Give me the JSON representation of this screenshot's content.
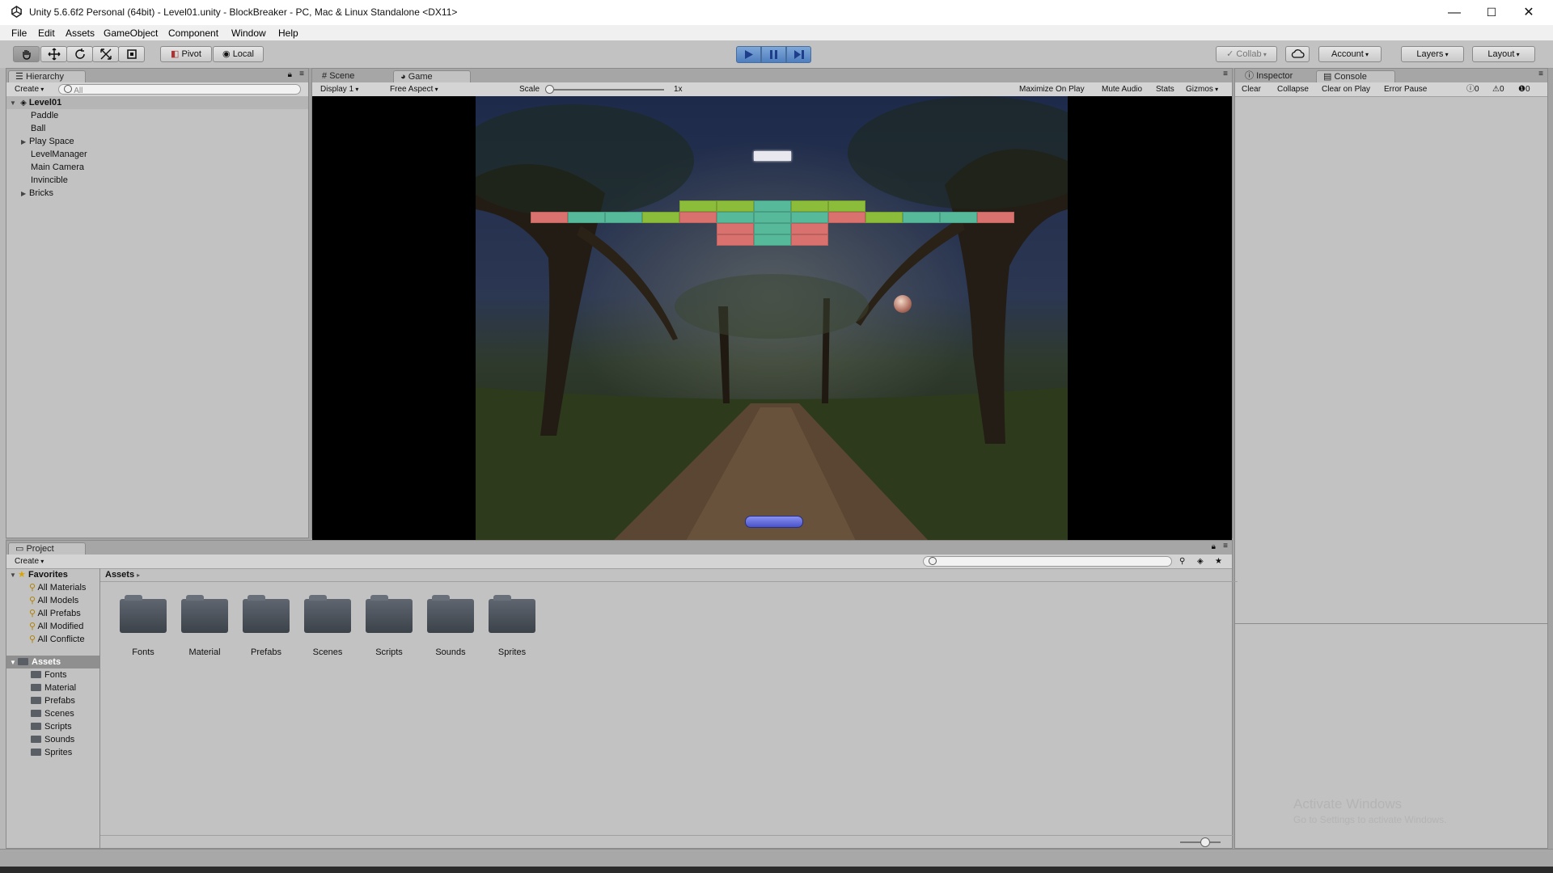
{
  "window": {
    "title": "Unity 5.6.6f2 Personal (64bit) - Level01.unity - BlockBreaker - PC, Mac & Linux Standalone <DX11>",
    "minimize": "—",
    "maximize": "☐",
    "close": "✕"
  },
  "menu": {
    "items": [
      {
        "label": "File"
      },
      {
        "label": "Edit"
      },
      {
        "label": "Assets"
      },
      {
        "label": "GameObject"
      },
      {
        "label": "Component"
      },
      {
        "label": "Window"
      },
      {
        "label": "Help"
      }
    ]
  },
  "toolbar": {
    "pivot": "Pivot",
    "local": "Local",
    "collab": "Collab",
    "account": "Account",
    "layers": "Layers",
    "layout": "Layout",
    "playing": true
  },
  "hierarchy": {
    "tab": "Hierarchy",
    "create": "Create",
    "search_placeholder": "All",
    "scene": "Level01",
    "items": [
      {
        "label": "Paddle",
        "expandable": false
      },
      {
        "label": "Ball",
        "expandable": false
      },
      {
        "label": "Play Space",
        "expandable": true
      },
      {
        "label": "LevelManager",
        "expandable": false
      },
      {
        "label": "Main Camera",
        "expandable": false
      },
      {
        "label": "Invincible",
        "expandable": false
      },
      {
        "label": "Bricks",
        "expandable": true
      }
    ]
  },
  "center": {
    "tabs": [
      {
        "label": "Scene",
        "active": false
      },
      {
        "label": "Game",
        "active": true
      }
    ],
    "display": "Display 1",
    "aspect": "Free Aspect",
    "scale_label": "Scale",
    "scale_value": "1x",
    "options": [
      "Maximize On Play",
      "Mute Audio",
      "Stats",
      "Gizmos"
    ]
  },
  "right": {
    "tabs": [
      {
        "label": "Inspector",
        "active": false
      },
      {
        "label": "Console",
        "active": true
      }
    ],
    "console_buttons": [
      "Clear",
      "Collapse",
      "Clear on Play",
      "Error Pause"
    ],
    "counts": {
      "info": "0",
      "warn": "0",
      "error": "0"
    },
    "watermark_title": "Activate Windows",
    "watermark_sub": "Go to Settings to activate Windows."
  },
  "project": {
    "tab": "Project",
    "create": "Create",
    "favorites_label": "Favorites",
    "favorites": [
      "All Materials",
      "All Models",
      "All Prefabs",
      "All Modified",
      "All Conflicte"
    ],
    "assets_label": "Assets",
    "asset_folders": [
      "Fonts",
      "Material",
      "Prefabs",
      "Scenes",
      "Scripts",
      "Sounds",
      "Sprites"
    ],
    "breadcrumb": "Assets"
  },
  "colors": {
    "play_active": "#5b8ad0",
    "brick_red": "#d9726e",
    "brick_teal": "#56b99a",
    "brick_green": "#8cbd3a",
    "paddle": "#4a54c8"
  },
  "game": {
    "bricks": [
      {
        "row": 0,
        "col": 4,
        "color": "green"
      },
      {
        "row": 0,
        "col": 5,
        "color": "green"
      },
      {
        "row": 0,
        "col": 6,
        "color": "teal"
      },
      {
        "row": 0,
        "col": 7,
        "color": "green"
      },
      {
        "row": 0,
        "col": 8,
        "color": "green"
      },
      {
        "row": 1,
        "col": 0,
        "color": "red"
      },
      {
        "row": 1,
        "col": 1,
        "color": "teal"
      },
      {
        "row": 1,
        "col": 2,
        "color": "teal"
      },
      {
        "row": 1,
        "col": 3,
        "color": "green"
      },
      {
        "row": 1,
        "col": 4,
        "color": "red"
      },
      {
        "row": 1,
        "col": 5,
        "color": "teal"
      },
      {
        "row": 1,
        "col": 6,
        "color": "teal"
      },
      {
        "row": 1,
        "col": 7,
        "color": "teal"
      },
      {
        "row": 1,
        "col": 8,
        "color": "red"
      },
      {
        "row": 1,
        "col": 9,
        "color": "green"
      },
      {
        "row": 1,
        "col": 10,
        "color": "teal"
      },
      {
        "row": 1,
        "col": 11,
        "color": "teal"
      },
      {
        "row": 1,
        "col": 12,
        "color": "red"
      },
      {
        "row": 2,
        "col": 5,
        "color": "red"
      },
      {
        "row": 2,
        "col": 6,
        "color": "teal"
      },
      {
        "row": 2,
        "col": 7,
        "color": "red"
      },
      {
        "row": 3,
        "col": 5,
        "color": "red"
      },
      {
        "row": 3,
        "col": 6,
        "color": "teal"
      },
      {
        "row": 3,
        "col": 7,
        "color": "red"
      }
    ]
  }
}
